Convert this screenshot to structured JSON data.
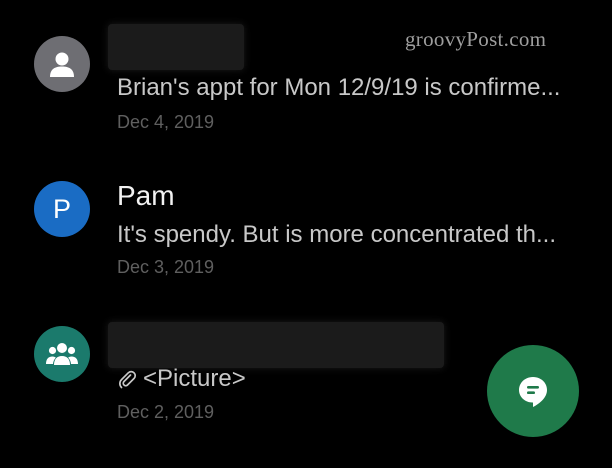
{
  "watermark": "groovyPost.com",
  "conversations": [
    {
      "avatar_icon": "person-icon",
      "avatar_color": "#6e6e73",
      "snippet": "Brian's appt for Mon 12/9/19 is confirme...",
      "date": "Dec 4, 2019"
    },
    {
      "avatar_letter": "P",
      "avatar_color": "#1a6cc4",
      "name": "Pam",
      "snippet": "It's spendy. But is more concentrated th...",
      "date": "Dec 3, 2019"
    },
    {
      "avatar_icon": "group-icon",
      "avatar_color": "#1b7a6c",
      "snippet_icon": "paperclip-icon",
      "snippet": "<Picture>",
      "date": "Dec 2, 2019"
    }
  ],
  "fab": {
    "icon": "new-message-icon",
    "color": "#1f7a4a"
  }
}
